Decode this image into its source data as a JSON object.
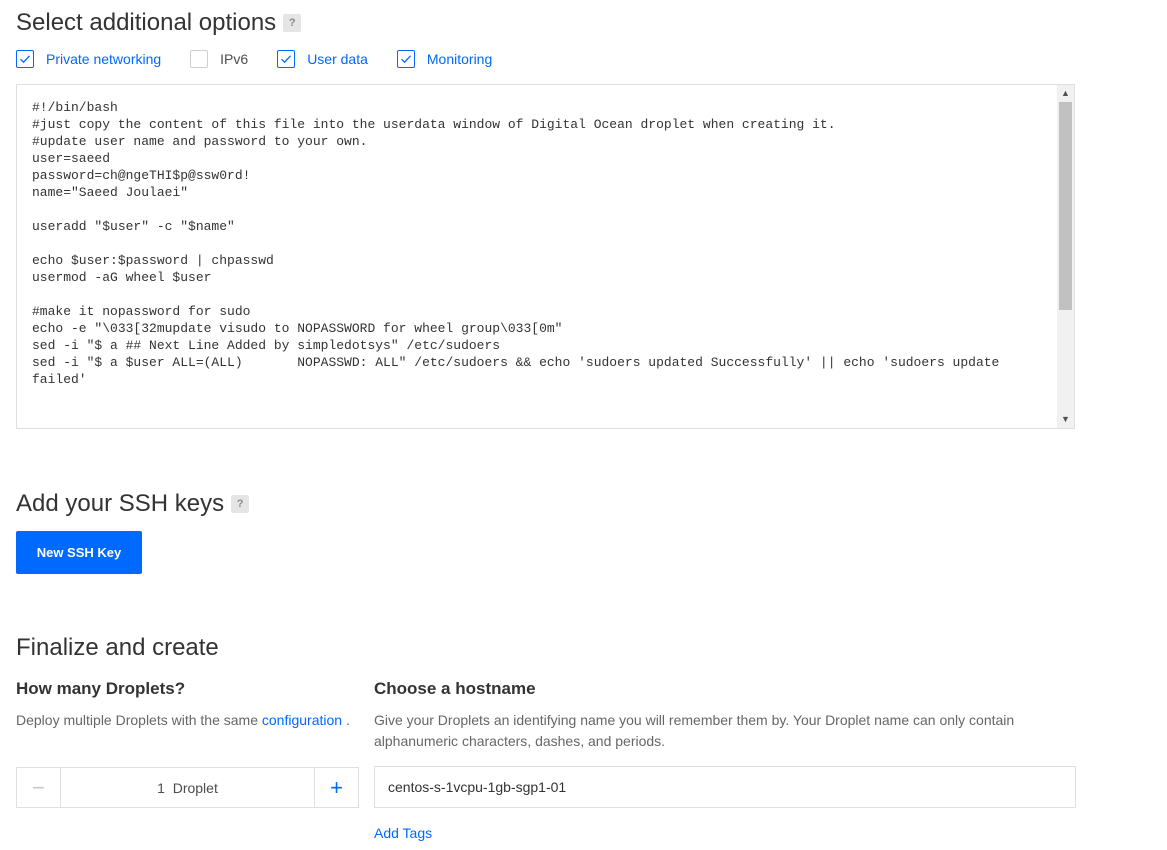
{
  "additional_options": {
    "title": "Select additional options",
    "help": "?",
    "options": [
      {
        "label": "Private networking",
        "checked": true
      },
      {
        "label": "IPv6",
        "checked": false
      },
      {
        "label": "User data",
        "checked": true
      },
      {
        "label": "Monitoring",
        "checked": true
      }
    ],
    "user_data": "#!/bin/bash\n#just copy the content of this file into the userdata window of Digital Ocean droplet when creating it.\n#update user name and password to your own.\nuser=saeed\npassword=ch@ngeTHI$p@ssw0rd!\nname=\"Saeed Joulaei\"\n\nuseradd \"$user\" -c \"$name\"\n\necho $user:$password | chpasswd\nusermod -aG wheel $user\n\n#make it nopassword for sudo\necho -e \"\\033[32mupdate visudo to NOPASSWORD for wheel group\\033[0m\"\nsed -i \"$ a ## Next Line Added by simpledotsys\" /etc/sudoers\nsed -i \"$ a $user ALL=(ALL)       NOPASSWD: ALL\" /etc/sudoers && echo 'sudoers updated Successfully' || echo 'sudoers update failed'"
  },
  "ssh_keys": {
    "title": "Add your SSH keys",
    "help": "?",
    "button_label": "New SSH Key"
  },
  "finalize": {
    "title": "Finalize and create",
    "droplets": {
      "title": "How many Droplets?",
      "desc_text": "Deploy multiple Droplets with the same",
      "desc_link": "configuration",
      "desc_end": ".",
      "minus": "−",
      "plus": "+",
      "count_label": "1  Droplet"
    },
    "hostname": {
      "title": "Choose a hostname",
      "desc": "Give your Droplets an identifying name you will remember them by. Your Droplet name can only contain alphanumeric characters, dashes, and periods.",
      "value": "centos-s-1vcpu-1gb-sgp1-01",
      "add_tags": "Add Tags"
    }
  },
  "colors": {
    "accent": "#0069ff",
    "text": "#333333",
    "muted": "#666666",
    "border": "#dfdfdf"
  }
}
